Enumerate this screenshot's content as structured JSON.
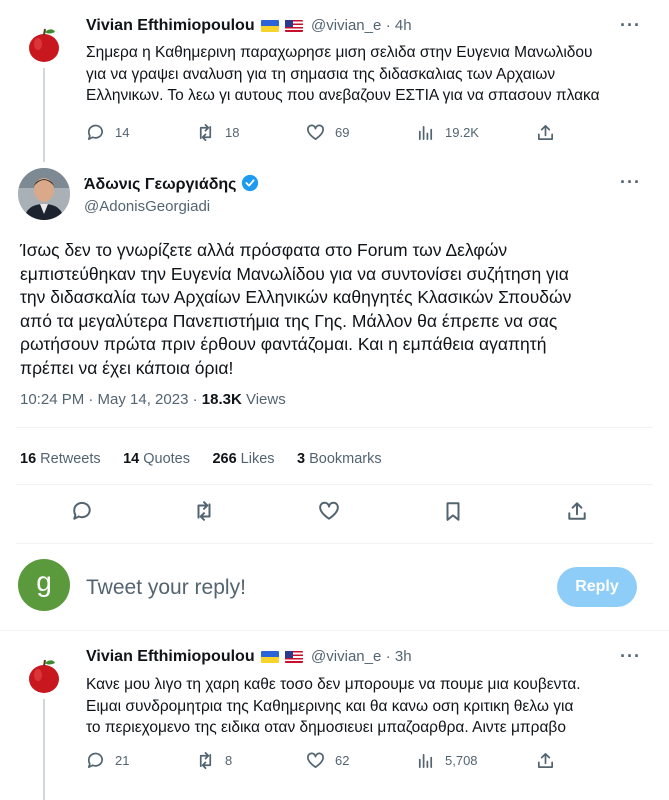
{
  "tweet1": {
    "name": "Vivian Efthimiopoulou",
    "handle": "@vivian_e",
    "time": "· 4h",
    "text_lines": [
      "Σημερα η Καθημερινη παραχωρησε μιση σελιδα στην Ευγενια Μανωλιδου",
      "για να γραψει αναλυση για τη σημασια της διδασκαλιας των Αρχαιων",
      "Ελληνικων. Το λεω γι αυτους που ανεβαζουν ΕΣΤΙΑ για να σπασουν πλακα"
    ],
    "replies": "14",
    "retweets": "18",
    "likes": "69",
    "views": "19.2K"
  },
  "main": {
    "name": "Άδωνις Γεωργιάδης",
    "handle": "@AdonisGeorgiadi",
    "text_lines": [
      "Ίσως δεν το γνωρίζετε αλλά πρόσφατα στο Forum των Δελφών",
      "εμπιστεύθηκαν την Ευγενία Μανωλίδου για να συντονίσει συζήτηση για",
      "την διδασκαλία των Αρχαίων Ελληνικών καθηγητές Κλασικών Σπουδών",
      "από τα μεγαλύτερα Πανεπιστήμια της Γης. Μάλλον θα έπρεπε να σας",
      "ρωτήσουν πρώτα πριν έρθουν φαντάζομαι. Και η εμπάθεια αγαπητή",
      "πρέπει να έχει κάποια όρια!"
    ],
    "timestamp": "10:24 PM · May 14, 2023 · ",
    "views_count": "18.3K",
    "views_label": " Views",
    "stats": [
      {
        "count": "16",
        "label": " Retweets"
      },
      {
        "count": "14",
        "label": " Quotes"
      },
      {
        "count": "266",
        "label": " Likes"
      },
      {
        "count": "3",
        "label": " Bookmarks"
      }
    ]
  },
  "reply_box": {
    "avatar_letter": "g",
    "placeholder": "Tweet your reply!",
    "button": "Reply"
  },
  "tweet2": {
    "name": "Vivian Efthimiopoulou",
    "handle": "@vivian_e",
    "time": "· 3h",
    "text_lines": [
      "Κανε μου λιγο τη χαρη καθε τοσο δεν μπορουμε να πουμε μια κουβεντα.",
      "Ειμαι συνδρομητρια της Καθημερινης και θα κανω οση κριτικη θελω για",
      "το περιεχομενο της ειδικα οταν δημοσιευει μπαζοαρθρα. Αιντε μπραβο"
    ],
    "replies": "21",
    "retweets": "8",
    "likes": "62",
    "views": "5,708"
  },
  "colors": {
    "accent": "#1d9bf0",
    "reply_button_disabled": "#8ecdf8",
    "avatar_g": "#5b9a3c",
    "verified": "#1d9bf0"
  }
}
